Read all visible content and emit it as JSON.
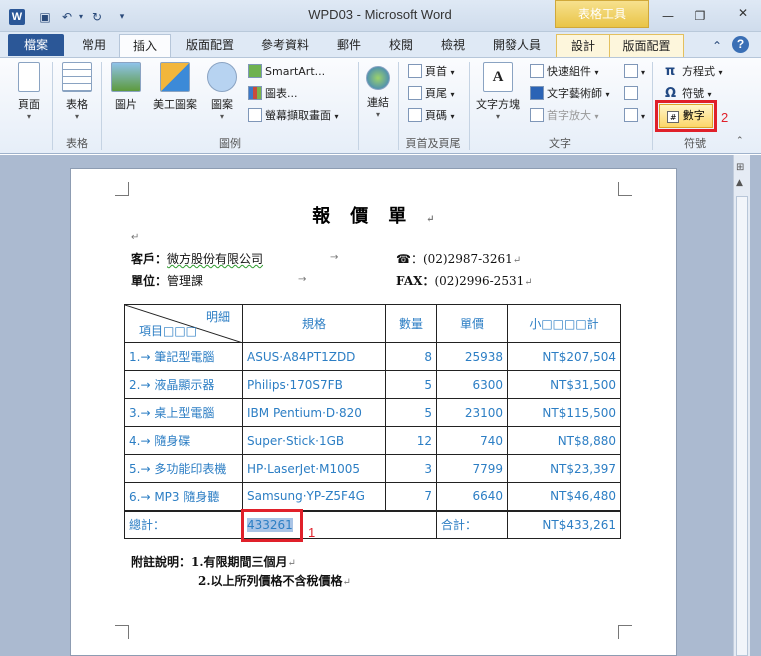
{
  "window": {
    "app_icon": "W",
    "title": "WPD03 - Microsoft Word",
    "contextual_tab_header": "表格工具"
  },
  "tabs": [
    "檔案",
    "常用",
    "插入",
    "版面配置",
    "參考資料",
    "郵件",
    "校閱",
    "檢視",
    "開發人員",
    "設計",
    "版面配置"
  ],
  "ribbon": {
    "page": "頁面",
    "table": "表格",
    "picture": "圖片",
    "clipart": "美工圖案",
    "shapes": "圖案",
    "smartart": "SmartArt...",
    "chart": "圖表...",
    "screenshot": "螢幕擷取畫面",
    "link": "連結",
    "header": "頁首",
    "footer": "頁尾",
    "page_number": "頁碼",
    "textbox": "文字方塊",
    "quickparts": "快速組件",
    "wordart": "文字藝術師",
    "dropcap": "首字放大",
    "equation": "方程式",
    "symbol": "符號",
    "number": "數字",
    "groups": {
      "tables": "表格",
      "illustrations": "圖例",
      "header_footer": "頁首及頁尾",
      "text": "文字",
      "symbols": "符號"
    }
  },
  "annotations": {
    "one": "1",
    "two": "2"
  },
  "document": {
    "title": "報價單",
    "customer_label": "客戶：",
    "customer_value": "微方股份有限公司",
    "phone_icon": "☎",
    "phone_value": "：(02)2987-3261",
    "unit_label": "單位：",
    "unit_value": "管理課",
    "fax_label": "FAX：",
    "fax_value": "(02)2996-2531",
    "table": {
      "header": {
        "diag_top": "明細",
        "diag_bottom": "項目□□□",
        "spec": "規格",
        "qty": "數量",
        "price": "單價",
        "subtotal": "小□□□□計"
      },
      "rows": [
        {
          "item": "1.→ 筆記型電腦",
          "spec": "ASUS·A84PT1ZDD",
          "qty": "8",
          "price": "25938",
          "subtotal": "NT$207,504"
        },
        {
          "item": "2.→ 液晶顯示器",
          "spec": "Philips·170S7FB",
          "qty": "5",
          "price": "6300",
          "subtotal": "NT$31,500"
        },
        {
          "item": "3.→ 桌上型電腦",
          "spec": "IBM Pentium·D·820",
          "qty": "5",
          "price": "23100",
          "subtotal": "NT$115,500"
        },
        {
          "item": "4.→ 隨身碟",
          "spec": "Super·Stick·1GB",
          "qty": "12",
          "price": "740",
          "subtotal": "NT$8,880"
        },
        {
          "item": "5.→ 多功能印表機",
          "spec": "HP·LaserJet·M1005",
          "qty": "3",
          "price": "7799",
          "subtotal": "NT$23,397"
        },
        {
          "item": "6.→ MP3 隨身聽",
          "spec": "Samsung·YP-Z5F4G",
          "qty": "7",
          "price": "6640",
          "subtotal": "NT$46,480"
        }
      ],
      "footer": {
        "total_qty_label": "總計：",
        "total_qty_value": "433261",
        "total_label": "合計：",
        "total_value": "NT$433,261"
      }
    },
    "notes_label": "附註說明：",
    "note1": "1.有限期間三個月",
    "note2": "2.以上所列價格不含稅價格"
  }
}
